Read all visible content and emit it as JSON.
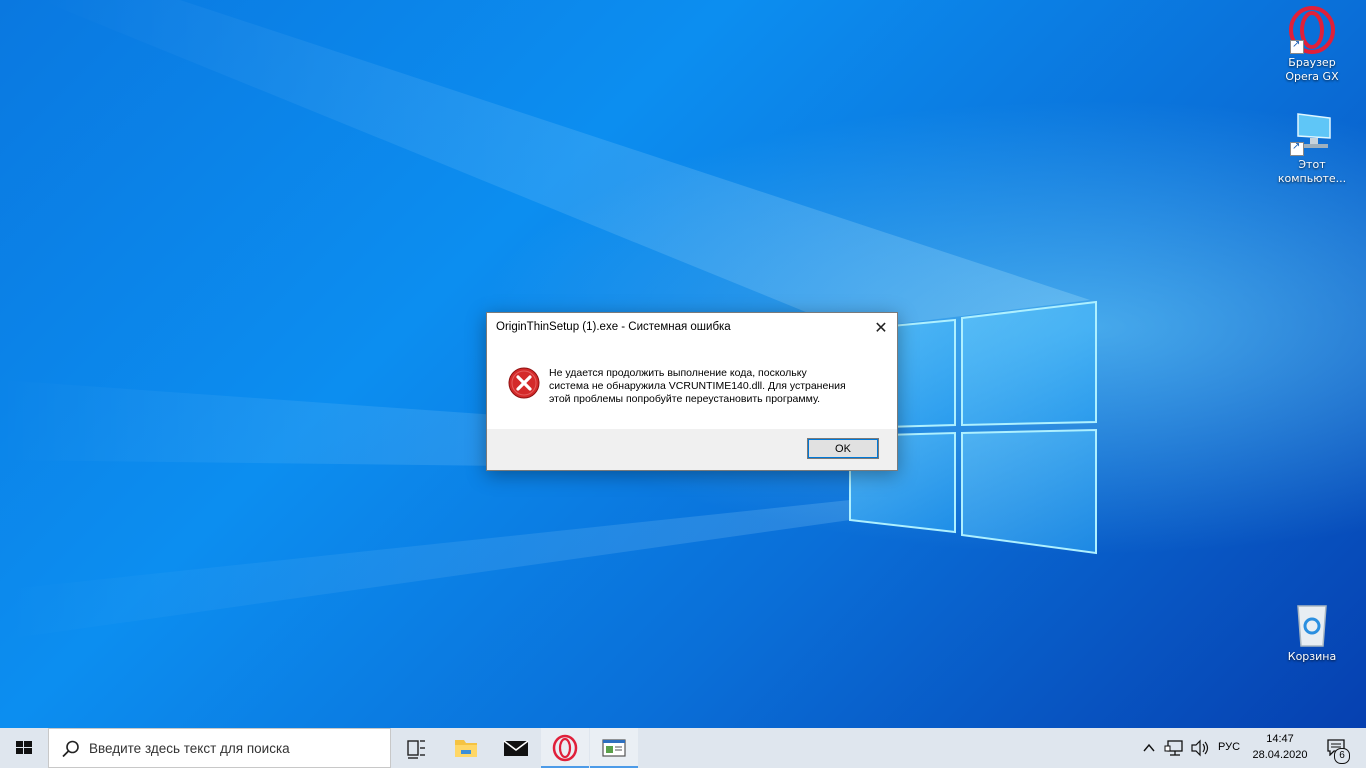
{
  "desktop": {
    "icons": [
      {
        "label_line1": "Браузер",
        "label_line2": "Opera GX",
        "icon": "opera-gx-icon"
      },
      {
        "label_line1": "Этот",
        "label_line2": "компьюте...",
        "icon": "this-pc-icon"
      },
      {
        "label_line1": "Корзина",
        "label_line2": "",
        "icon": "recycle-bin-icon"
      }
    ]
  },
  "dialog": {
    "title": "OriginThinSetup (1).exe - Системная ошибка",
    "close_glyph": "✕",
    "message_line1": "Не удается продолжить выполнение кода, поскольку",
    "message_line2": "система не обнаружила VCRUNTIME140.dll. Для устранения",
    "message_line3": "этой проблемы попробуйте переустановить программу.",
    "ok_label": "OK"
  },
  "taskbar": {
    "search_placeholder": "Введите здесь текст для поиска",
    "apps": [
      "task-view-icon",
      "file-explorer-icon",
      "mail-icon",
      "opera-icon",
      "app-window-icon"
    ],
    "tray": {
      "language": "РУС",
      "time": "14:47",
      "date": "28.04.2020",
      "notification_count": "6"
    }
  },
  "colors": {
    "desktop_blue": "#0a78e0",
    "error_red": "#d42a2a",
    "opera_red": "#e0203a",
    "taskbar_bg": "#dfe6ee"
  }
}
